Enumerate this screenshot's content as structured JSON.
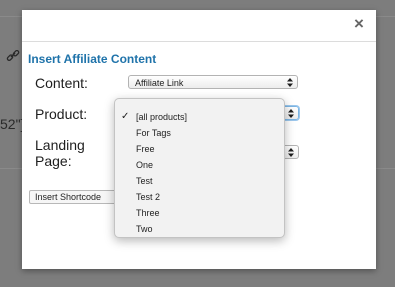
{
  "background": {
    "partial_text": "52\"]"
  },
  "modal": {
    "title": "Insert Affiliate Content",
    "close_glyph": "×",
    "fields": {
      "content_label": "Content:",
      "content_value": "Affiliate Link",
      "product_label": "Product:",
      "landing_label_line1": "Landing",
      "landing_label_line2": "Page:"
    },
    "insert_button_label": "Insert Shortcode"
  },
  "product_dropdown": {
    "selected": "[all products]",
    "options": [
      "[all products]",
      "For Tags",
      "Free",
      "One",
      "Test",
      "Test 2",
      "Three",
      "Two"
    ],
    "check_glyph": "✓"
  },
  "colors": {
    "title_blue": "#1f73aa",
    "overlay": "#7d7d7d",
    "focus_ring": "#7cb5e4"
  },
  "icons": {
    "link": "link-icon",
    "close": "close-icon",
    "select_arrows": "updown-arrows-icon",
    "checkmark": "checkmark-icon"
  }
}
